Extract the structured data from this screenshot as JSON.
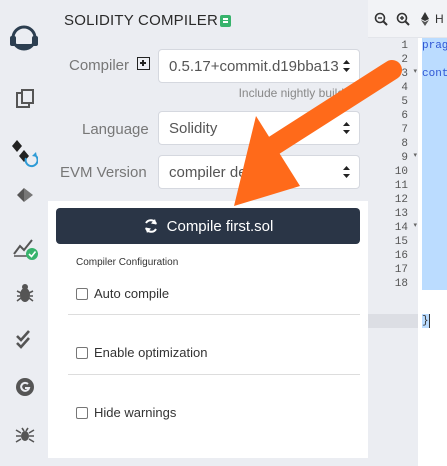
{
  "panel": {
    "title": "SOLIDITY COMPILER",
    "compiler_label": "Compiler",
    "compiler_value": "0.5.17+commit.d19bba13",
    "nightly_label": "Include nightly builds",
    "language_label": "Language",
    "language_value": "Solidity",
    "evm_label": "EVM Version",
    "evm_value": "compiler default",
    "compile_button": "Compile first.sol",
    "config_title": "Compiler Configuration",
    "auto_compile": "Auto compile",
    "enable_optimization": "Enable optimization",
    "hide_warnings": "Hide warnings"
  },
  "sidebar": {
    "icons": [
      "remix-logo-icon",
      "file-explorer-icon",
      "solidity-compiler-icon",
      "deploy-run-icon",
      "analysis-icon",
      "debugger-icon",
      "testing-icon",
      "git-icon",
      "bug-icon"
    ]
  },
  "editor": {
    "tab_fragment": "H",
    "line_numbers": [
      "1",
      "2",
      "3",
      "4",
      "5",
      "6",
      "7",
      "8",
      "9",
      "10",
      "11",
      "12",
      "13",
      "14",
      "15",
      "16",
      "17",
      "18"
    ],
    "code_line1": "prag",
    "code_line3": "cont",
    "code_line18": "}"
  },
  "colors": {
    "accent": "#2a3546",
    "panel_bg": "#ebedf2",
    "arrow": "#ff6a1a",
    "selection": "#bbdcff",
    "success": "#37b36c"
  }
}
